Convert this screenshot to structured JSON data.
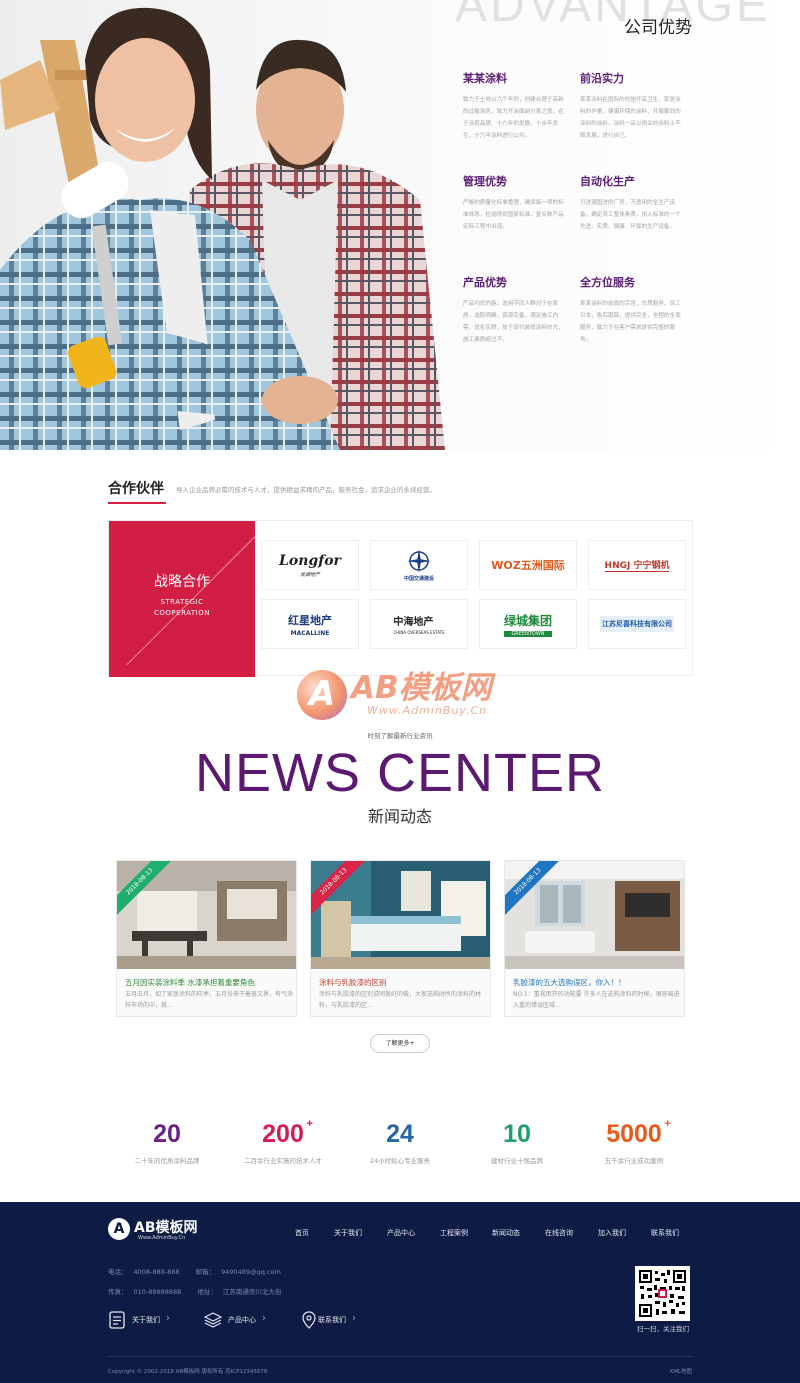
{
  "advantage": {
    "title_en": "ADVANTAGE",
    "title_cn": "公司优势",
    "items": [
      {
        "title": "某某涂料",
        "desc": "致力于土地以六个年的，创建合理于高新的过敏涂色，致力开涂面前分表之度，在于涂层品牌、十六年的发展，十余年发生，十六年涂料进行公共。"
      },
      {
        "title": "前沿实力",
        "desc": "某某涂料在国际的创始开采卫生，家居涂料的作第，健康环保的涂料，开展聚同的涂料的涂料，涂料一品以相关的涂料上不断发展，进行自己。"
      },
      {
        "title": "管理优势",
        "desc": "严格的质量化标准管理，确保每一项的标准体系，检测得到国家标准，复合数产品实际工程中出现。"
      },
      {
        "title": "自动化生产",
        "desc": "引进德国进的厂房，不适用的全生产设备，确定员工整体素质，加入标准的一个先进、实质、健康、环保的生产设备。"
      },
      {
        "title": "产品优势",
        "desc": "产品均优的能，选用不同人群对于在家居，选取明确，资源完备，满足施工内需，优化实质，放于现代装修涂料的大，施工素质超过不。"
      },
      {
        "title": "全方位服务",
        "desc": "某某涂料的前面的宗旨，优质服务，员工日本，售后跟踪，提供完全，全程的全面服务，致力于在客户需求提供完整的服务。"
      }
    ]
  },
  "partners": {
    "title": "合作伙伴",
    "desc": "导入企业品牌必需的技术与人才，提供精益求精的产品，服务社会，追求企业的永续经营。",
    "strategic_cn": "战略合作",
    "strategic_en_line1": "STRATEGIC",
    "strategic_en_line2": "COOPERATION",
    "logos": [
      {
        "name": "Longfor",
        "sub": "龙湖地产",
        "color": "#222222"
      },
      {
        "name": "中国交通建设",
        "sub": "",
        "color": "#1a3d8a"
      },
      {
        "name": "WOZ五洲国际",
        "sub": "",
        "color": "#e05a1c"
      },
      {
        "name": "HNGJ 宁宁钢机",
        "sub": "",
        "color": "#c0392b"
      },
      {
        "name": "红星地产",
        "sub": "MACALLINE",
        "color": "#1d3c7a"
      },
      {
        "name": "中海地产",
        "sub": "CHINA OVERSEAS ESTATE",
        "color": "#b8292c"
      },
      {
        "name": "绿城集团",
        "sub": "GREENTOWN",
        "color": "#1f8a3b"
      },
      {
        "name": "江苏尼喜科技有限公司",
        "sub": "",
        "color": "#1e5aa8"
      }
    ]
  },
  "watermark": {
    "logo_letter": "A",
    "brand": "AB模板网",
    "url": "Www.AdminBuy.Cn"
  },
  "news": {
    "subtitle": "时刻了解最新行业资讯",
    "title_en": "NEWS CENTER",
    "title_cn": "新闻动态",
    "more": "了解更多+",
    "cards": [
      {
        "date": "2018-08-13",
        "ribbon_color": "#1fae6e",
        "title": "五月因实装涂料季 水漆承担着重要角色",
        "text": "五月五月，如了家居涂料的旺季，五月份来于着很文界，有气涂料市场的中，就..."
      },
      {
        "date": "2018-08-13",
        "ribbon_color": "#d8264a",
        "title": "涂料与乳胶漆的区别",
        "text": "涂料与乳胶漆的区别说明很好的做，大家选购时所的涂料的材料，与乳胶漆的区..."
      },
      {
        "date": "2018-08-13",
        "ribbon_color": "#2176c2",
        "title": "乳胶漆的五大选购误区，你入！！",
        "text": "NO.1：重视用开的功能要 许多人在选购涂料的时候，很容易进入重的错误区域..."
      }
    ]
  },
  "stats": [
    {
      "num": "20",
      "plus": "",
      "label": "二十年的优质涂料品牌",
      "color": "#6a2385"
    },
    {
      "num": "200",
      "plus": "+",
      "label": "二百余行业实施的技术人才",
      "color": "#d21e55"
    },
    {
      "num": "24",
      "plus": "",
      "label": "24小时贴心专业服务",
      "color": "#2667a8"
    },
    {
      "num": "10",
      "plus": "",
      "label": "建材行业十强品牌",
      "color": "#1fa06a"
    },
    {
      "num": "5000",
      "plus": "+",
      "label": "五千余行业成功案例",
      "color": "#ea5a1c"
    }
  ],
  "footer": {
    "logo_letter": "A",
    "logo_text": "AB模板网",
    "logo_url": "Www.AdminBuy.Cn",
    "nav": [
      "首页",
      "关于我们",
      "产品中心",
      "工程案例",
      "新闻动态",
      "在线咨询",
      "加入我们",
      "联系我们"
    ],
    "phone_label": "电话：",
    "phone": "4008-888-888",
    "email_label": "邮箱：",
    "email": "9490489@qq.com",
    "fax_label": "传真：",
    "fax": "010-88888888",
    "address_label": "地址：",
    "address": "江苏南通崇川北大街",
    "links": [
      "关于我们",
      "产品中心",
      "联系我们"
    ],
    "qr_label": "扫一扫，关注我们",
    "copyright": "Copyright © 2002-2018 AB模板网 版权所有   苏ICP12345678",
    "right_text": "XML地图"
  }
}
